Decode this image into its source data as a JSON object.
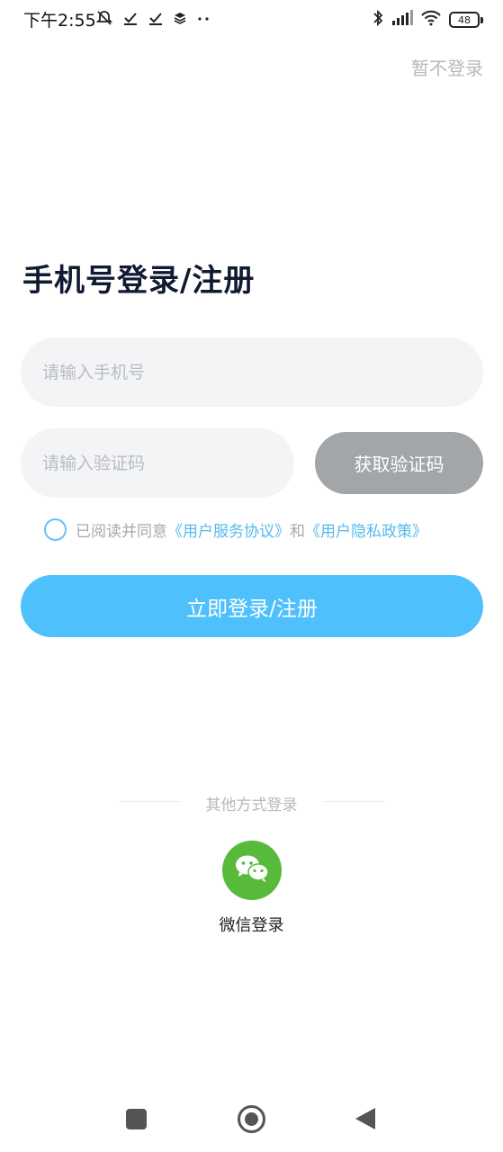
{
  "status_bar": {
    "time": "下午2:55",
    "battery": "48"
  },
  "header": {
    "skip_label": "暂不登录"
  },
  "form": {
    "title": "手机号登录/注册",
    "phone_placeholder": "请输入手机号",
    "phone_value": "",
    "code_placeholder": "请输入验证码",
    "code_value": "",
    "get_code_label": "获取验证码",
    "agreement_prefix": "已阅读并同意",
    "user_agreement_link": "《用户服务协议》",
    "agreement_and": "和",
    "privacy_link": "《用户隐私政策》",
    "agreement_checked": false,
    "submit_label": "立即登录/注册"
  },
  "other_login": {
    "divider_label": "其他方式登录",
    "wechat_label": "微信登录"
  },
  "colors": {
    "accent": "#4ec0fb",
    "disabled_button": "#a3a6a9",
    "wechat_green": "#58ba3b",
    "link": "#56b9ec"
  },
  "icons": {
    "checkbox": "radio-circle-icon",
    "wechat": "wechat-icon",
    "nav": [
      "recent-apps-icon",
      "home-icon",
      "back-icon"
    ]
  }
}
